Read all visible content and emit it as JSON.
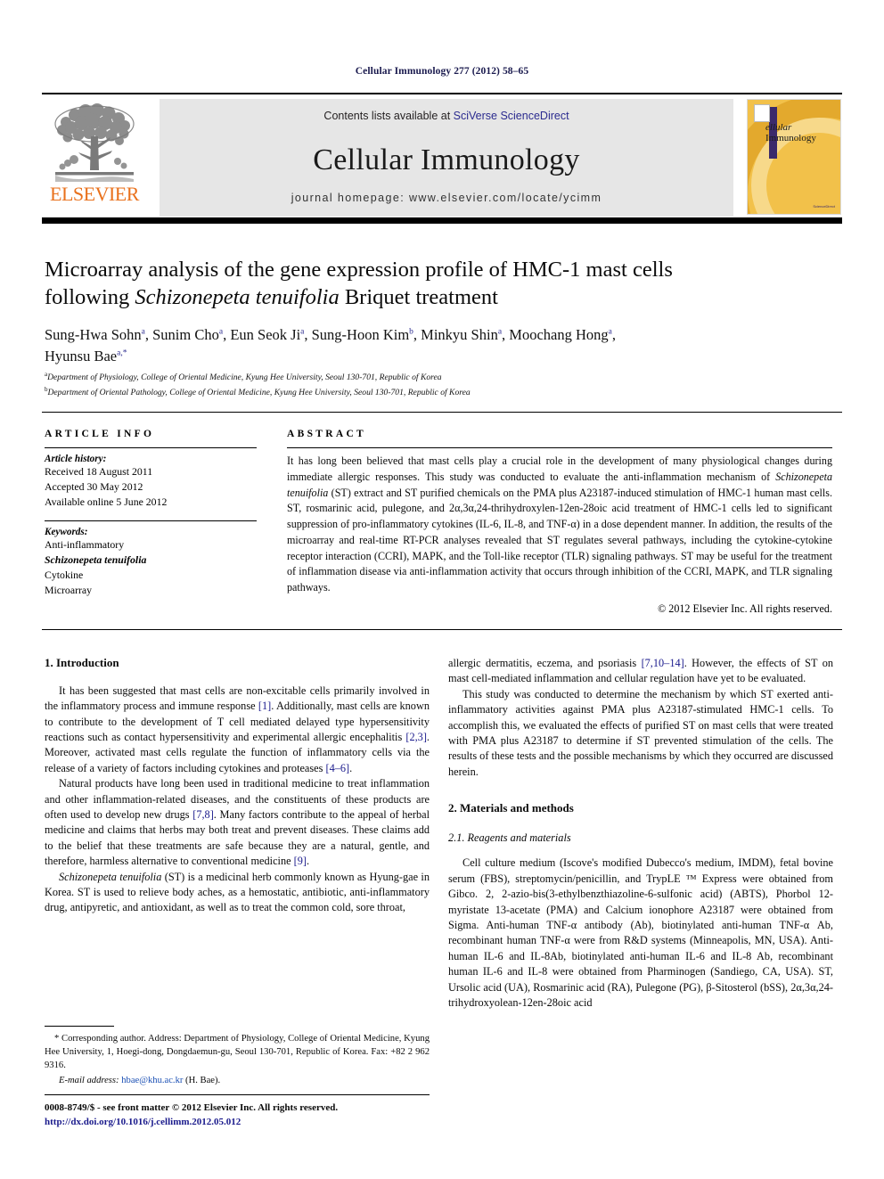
{
  "running_head": "Cellular Immunology 277 (2012) 58–65",
  "masthead": {
    "publisher_logo_label": "ELSEVIER",
    "contents_prefix": "Contents lists available at ",
    "contents_link": "SciVerse ScienceDirect",
    "journal_name": "Cellular Immunology",
    "homepage_label": "journal homepage: www.elsevier.com/locate/ycimm",
    "cover_title_line1": "ellular",
    "cover_title_line2": "Immunology",
    "cover_footer": "ScienceDirect"
  },
  "article": {
    "title_line1": "Microarray analysis of the gene expression profile of HMC-1 mast cells",
    "title_line2_pre": "following ",
    "title_line2_ital": "Schizonepeta tenuifolia",
    "title_line2_post": " Briquet treatment",
    "authors": "Sung-Hwa Sohn a, Sunim Cho a, Eun Seok Ji a, Sung-Hoon Kim b, Minkyu Shin a, Moochang Hong a, Hyunsu Bae a,*",
    "affiliation_a": "Department of Physiology, College of Oriental Medicine, Kyung Hee University, Seoul 130-701, Republic of Korea",
    "affiliation_b": "Department of Oriental Pathology, College of Oriental Medicine, Kyung Hee University, Seoul 130-701, Republic of Korea"
  },
  "article_info": {
    "heading": "ARTICLE INFO",
    "history_label": "Article history:",
    "received": "Received 18 August 2011",
    "accepted": "Accepted 30 May 2012",
    "available": "Available online 5 June 2012",
    "keywords_label": "Keywords:",
    "keywords": [
      "Anti-inflammatory",
      "Schizonepeta tenuifolia",
      "Cytokine",
      "Microarray"
    ]
  },
  "abstract": {
    "heading": "ABSTRACT",
    "part1": "It has long been believed that mast cells play a crucial role in the development of many physiological changes during immediate allergic responses. This study was conducted to evaluate the anti-inflammation mechanism of ",
    "italic1": "Schizonepeta tenuifolia",
    "part2": " (ST) extract and ST purified chemicals on the PMA plus A23187-induced stimulation of HMC-1 human mast cells. ST, rosmarinic acid, pulegone, and 2α,3α,24-thrihydroxylen-12en-28oic acid treatment of HMC-1 cells led to significant suppression of pro-inflammatory cytokines (IL-6, IL-8, and TNF-α) in a dose dependent manner. In addition, the results of the microarray and real-time RT-PCR analyses revealed that ST regulates several pathways, including the cytokine-cytokine receptor interaction (CCRI), MAPK, and the Toll-like receptor (TLR) signaling pathways. ST may be useful for the treatment of inflammation disease via anti-inflammation activity that occurs through inhibition of the CCRI, MAPK, and TLR signaling pathways.",
    "copyright": "© 2012 Elsevier Inc. All rights reserved."
  },
  "body": {
    "left": {
      "section1_heading": "1. Introduction",
      "p1_a": "It has been suggested that mast cells are non-excitable cells primarily involved in the inflammatory process and immune response ",
      "p1_r1": "[1]",
      "p1_b": ". Additionally, mast cells are known to contribute to the development of T cell mediated delayed type hypersensitivity reactions such as contact hypersensitivity and experimental allergic encephalitis ",
      "p1_r2": "[2,3]",
      "p1_c": ". Moreover, activated mast cells regulate the function of inflammatory cells via the release of a variety of factors including cytokines and proteases ",
      "p1_r3": "[4–6]",
      "p1_d": ".",
      "p2_a": "Natural products have long been used in traditional medicine to treat inflammation and other inflammation-related diseases, and the constituents of these products are often used to develop new drugs ",
      "p2_r1": "[7,8]",
      "p2_b": ". Many factors contribute to the appeal of herbal medicine and claims that herbs may both treat and prevent diseases. These claims add to the belief that these treatments are safe because they are a natural, gentle, and therefore, harmless alternative to conventional medicine ",
      "p2_r2": "[9]",
      "p2_c": ".",
      "p3_ital": "Schizonepeta tenuifolia",
      "p3_a": " (ST) is a medicinal herb commonly known as Hyung-gae in Korea. ST is used to relieve body aches, as a hemostatic, antibiotic, anti-inflammatory drug, antipyretic, and antioxidant, as well as to treat the common cold, sore throat,"
    },
    "right": {
      "p1_a": "allergic dermatitis, eczema, and psoriasis ",
      "p1_r1": "[7,10–14]",
      "p1_b": ". However, the effects of ST on mast cell-mediated inflammation and cellular regulation have yet to be evaluated.",
      "p2": "This study was conducted to determine the mechanism by which ST exerted anti-inflammatory activities against PMA plus A23187-stimulated HMC-1 cells. To accomplish this, we evaluated the effects of purified ST on mast cells that were treated with PMA plus A23187 to determine if ST prevented stimulation of the cells. The results of these tests and the possible mechanisms by which they occurred are discussed herein.",
      "section2_heading": "2. Materials and methods",
      "subsection21_heading": "2.1. Reagents and materials",
      "p3": "Cell culture medium (Iscove's modified Dubecco's medium, IMDM), fetal bovine serum (FBS), streptomycin/penicillin, and TrypLE ™ Express were obtained from Gibco. 2, 2-azio-bis(3-ethylbenzthiazoline-6-sulfonic acid) (ABTS), Phorbol 12-myristate 13-acetate (PMA) and Calcium ionophore A23187 were obtained from Sigma. Anti-human TNF-α antibody (Ab), biotinylated anti-human TNF-α Ab, recombinant human TNF-α were from R&D systems (Minneapolis, MN, USA). Anti-human IL-6 and IL-8Ab, biotinylated anti-human IL-6 and IL-8 Ab, recombinant human IL-6 and IL-8 were obtained from Pharminogen (Sandiego, CA, USA). ST, Ursolic acid (UA), Rosmarinic acid (RA), Pulegone (PG), β-Sitosterol (bSS), 2α,3α,24-trihydroxyolean-12en-28oic acid"
    }
  },
  "footnotes": {
    "corresponding": "* Corresponding author. Address: Department of Physiology, College of Oriental Medicine, Kyung Hee University, 1, Hoegi-dong, Dongdaemun-gu, Seoul 130-701, Republic of Korea. Fax: +82 2 962 9316.",
    "email_label": "E-mail address:",
    "email": "hbae@khu.ac.kr",
    "email_suffix": " (H. Bae)."
  },
  "imprint": {
    "line1": "0008-8749/$ - see front matter © 2012 Elsevier Inc. All rights reserved.",
    "doi": "http://dx.doi.org/10.1016/j.cellimm.2012.05.012"
  },
  "colors": {
    "elsevier_orange": "#E9711C",
    "link_blue": "#1a1a8c",
    "band_gray": "#e6e6e6",
    "cover_yellow": "#f2c14a"
  }
}
